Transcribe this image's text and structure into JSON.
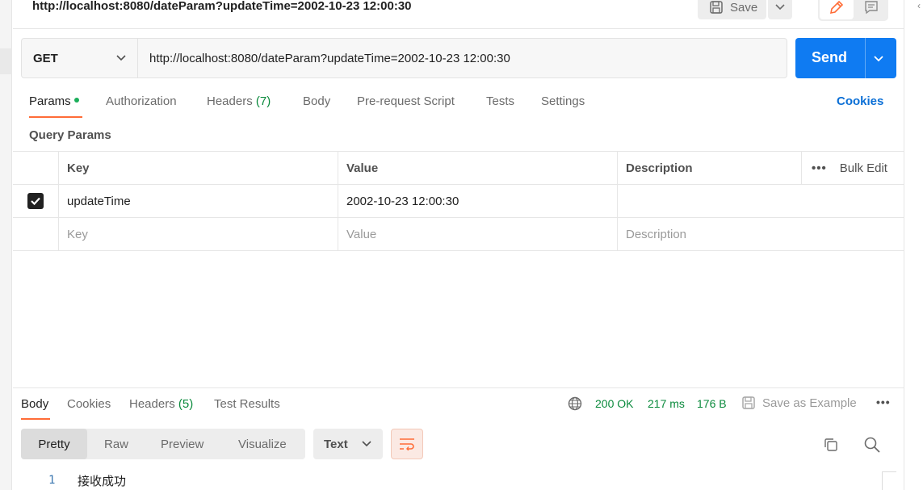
{
  "request": {
    "title": "http://localhost:8080/dateParam?updateTime=2002-10-23 12:00:30",
    "method": "GET",
    "url": "http://localhost:8080/dateParam?updateTime=2002-10-23 12:00:30",
    "send_label": "Send",
    "save_label": "Save"
  },
  "request_tabs": [
    {
      "label": "Params"
    },
    {
      "label": "Authorization"
    },
    {
      "label": "Headers",
      "count": "(7)"
    },
    {
      "label": "Body"
    },
    {
      "label": "Pre-request Script"
    },
    {
      "label": "Tests"
    },
    {
      "label": "Settings"
    }
  ],
  "cookies_label": "Cookies",
  "query_params": {
    "title": "Query Params",
    "columns": {
      "key": "Key",
      "value": "Value",
      "description": "Description"
    },
    "bulk_edit": "Bulk Edit",
    "rows": [
      {
        "checked": true,
        "key": "updateTime",
        "value": "2002-10-23 12:00:30",
        "description": ""
      }
    ],
    "placeholders": {
      "key": "Key",
      "value": "Value",
      "description": "Description"
    }
  },
  "response": {
    "tabs": [
      {
        "label": "Body"
      },
      {
        "label": "Cookies"
      },
      {
        "label": "Headers",
        "count": "(5)"
      },
      {
        "label": "Test Results"
      }
    ],
    "status": "200 OK",
    "time": "217 ms",
    "size": "176 B",
    "save_example": "Save as Example",
    "formats": [
      "Pretty",
      "Raw",
      "Preview",
      "Visualize"
    ],
    "type": "Text",
    "lines": [
      {
        "no": "1",
        "text": "接收成功"
      }
    ]
  },
  "colors": {
    "send": "#0f7bf2",
    "accent": "#ff6c37",
    "success": "#0a8a3c",
    "link": "#0b6fd6"
  }
}
